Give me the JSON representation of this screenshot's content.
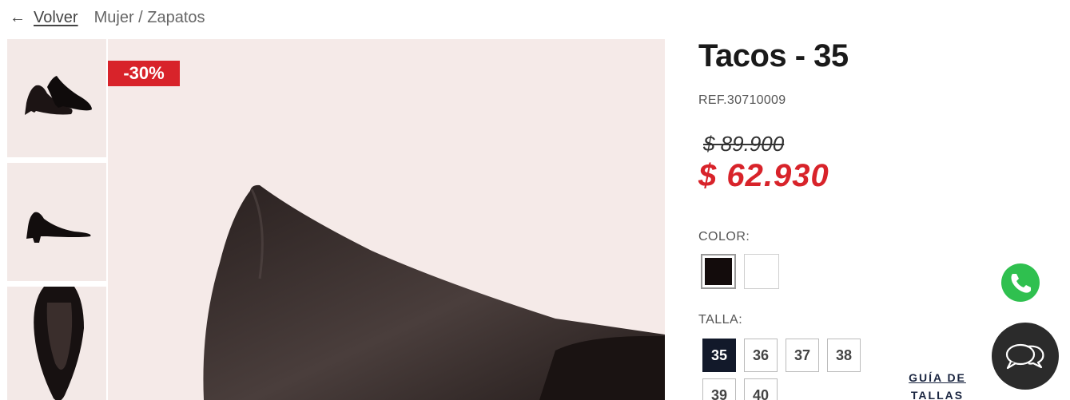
{
  "breadcrumb": {
    "back_icon": "arrow-left-icon",
    "back_label": "Volver",
    "path": "Mujer / Zapatos"
  },
  "product": {
    "title": "Tacos - 35",
    "ref": "REF.30710009",
    "discount_badge": "-30%",
    "old_price": "$ 89.900",
    "new_price": "$ 62.930"
  },
  "color": {
    "label": "COLOR:",
    "options": [
      {
        "name": "black",
        "hex": "#130c0c",
        "selected": true
      },
      {
        "name": "white",
        "hex": "#ffffff",
        "selected": false
      }
    ]
  },
  "size": {
    "label": "TALLA:",
    "options": [
      "35",
      "36",
      "37",
      "38",
      "39",
      "40"
    ],
    "selected": "35",
    "guide": "GUÍA DE TALLAS"
  },
  "colors": {
    "accent_red": "#d8232a",
    "navy": "#12192a",
    "image_bg": "#f5eae8"
  },
  "floating": {
    "whatsapp_icon": "whatsapp-icon",
    "chat_icon": "chat-bubbles-icon"
  }
}
